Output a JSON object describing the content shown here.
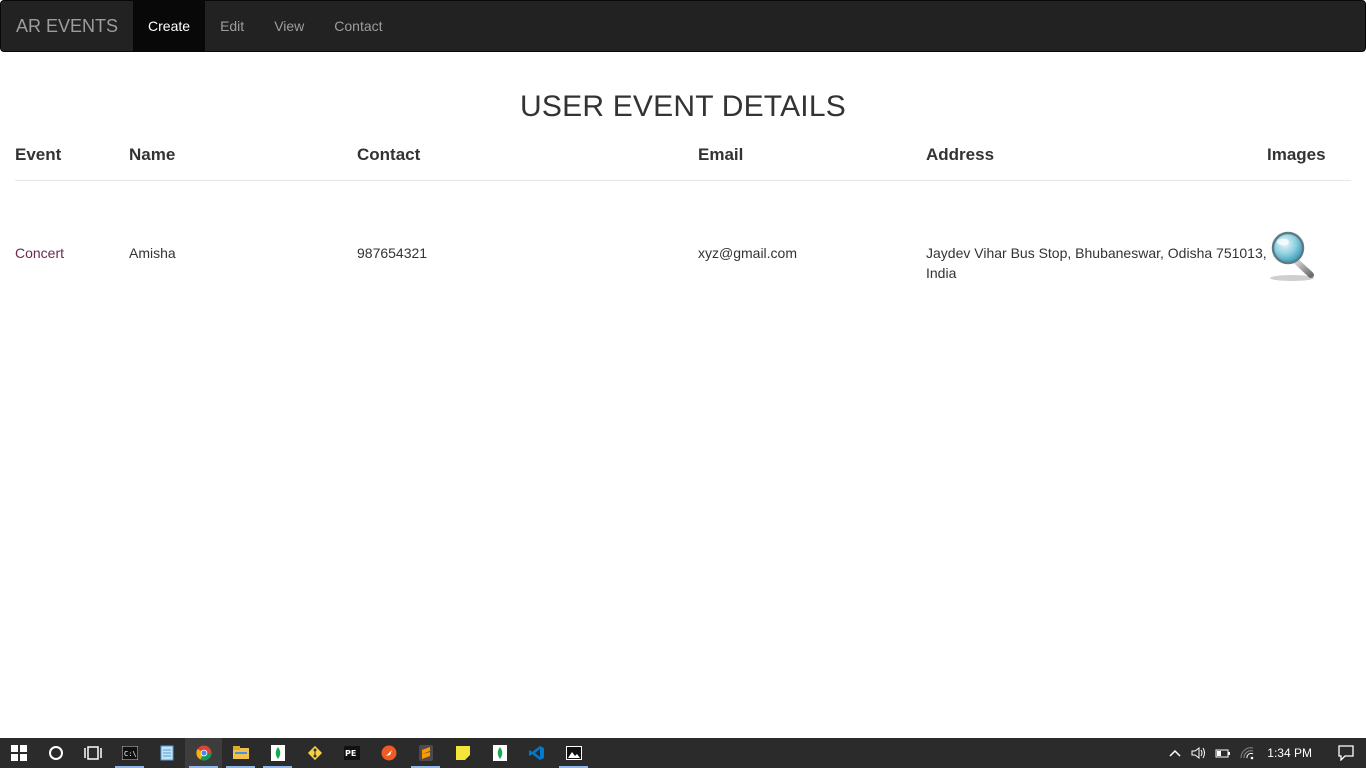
{
  "navbar": {
    "brand": "AR EVENTS",
    "items": [
      {
        "label": "Create",
        "active": true
      },
      {
        "label": "Edit",
        "active": false
      },
      {
        "label": "View",
        "active": false
      },
      {
        "label": "Contact",
        "active": false
      }
    ]
  },
  "page": {
    "title": "USER EVENT DETAILS"
  },
  "table": {
    "headers": [
      "Event",
      "Name",
      "Contact",
      "Email",
      "Address",
      "Images"
    ],
    "rows": [
      {
        "event": "Concert",
        "name": "Amisha",
        "contact": "987654321",
        "email": "xyz@gmail.com",
        "address": "Jaydev Vihar Bus Stop, Bhubaneswar, Odisha 751013, India",
        "image_icon": "magnifier-icon"
      }
    ]
  },
  "taskbar": {
    "icons": [
      "windows-start-icon",
      "cortana-icon",
      "task-view-icon",
      "cmd-icon",
      "notepad-icon",
      "chrome-icon",
      "file-explorer-icon",
      "mongodb-icon",
      "git-icon",
      "pe-icon",
      "postman-icon",
      "sublime-icon",
      "sticky-notes-icon",
      "mongodb-compass-icon",
      "vscode-icon",
      "photos-icon"
    ],
    "clock": "1:34 PM"
  },
  "colors": {
    "navbar_bg": "#222222",
    "navbar_active_bg": "#080808",
    "event_link": "#6a2a4f",
    "taskbar_bg": "#2b2b2b"
  }
}
